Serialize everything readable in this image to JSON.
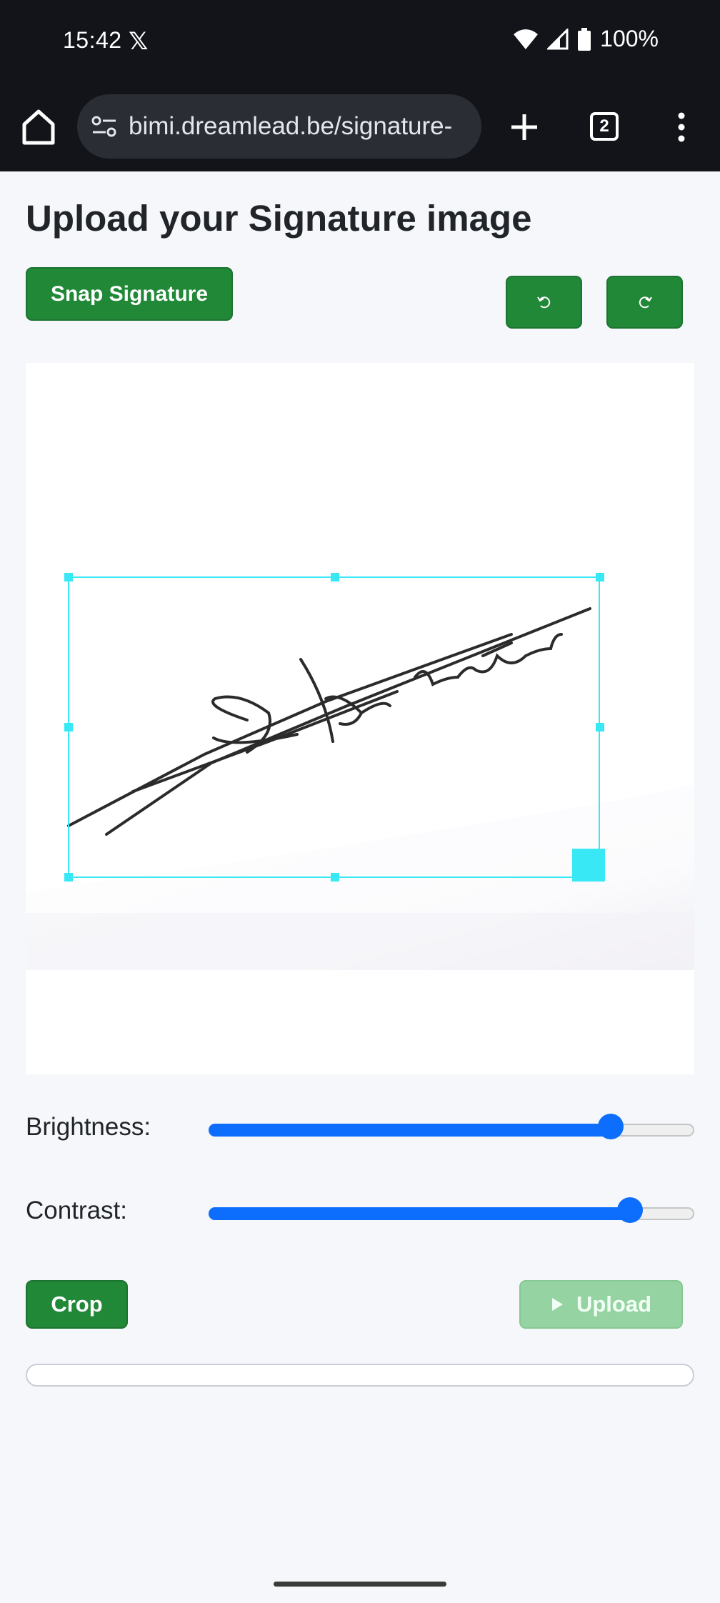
{
  "status_bar": {
    "time": "15:42",
    "notification_icon": "x-logo-icon",
    "battery": "100%"
  },
  "browser": {
    "url": "bimi.dreamlead.be/signature-",
    "tab_count": "2"
  },
  "page": {
    "title": "Upload your Signature image",
    "snap_button": "Snap Signature",
    "rotate_left_icon": "rotate-left-icon",
    "rotate_right_icon": "rotate-right-icon"
  },
  "adjustments": {
    "brightness_label": "Brightness:",
    "brightness_value": 0.83,
    "contrast_label": "Contrast:",
    "contrast_value": 0.87
  },
  "actions": {
    "crop_label": "Crop",
    "upload_label": "Upload",
    "upload_disabled": true
  },
  "progress": {
    "value": 0
  },
  "colors": {
    "accent_green": "#218838",
    "slider_blue": "#0d6efd",
    "crop_cyan": "#39e8f5"
  }
}
